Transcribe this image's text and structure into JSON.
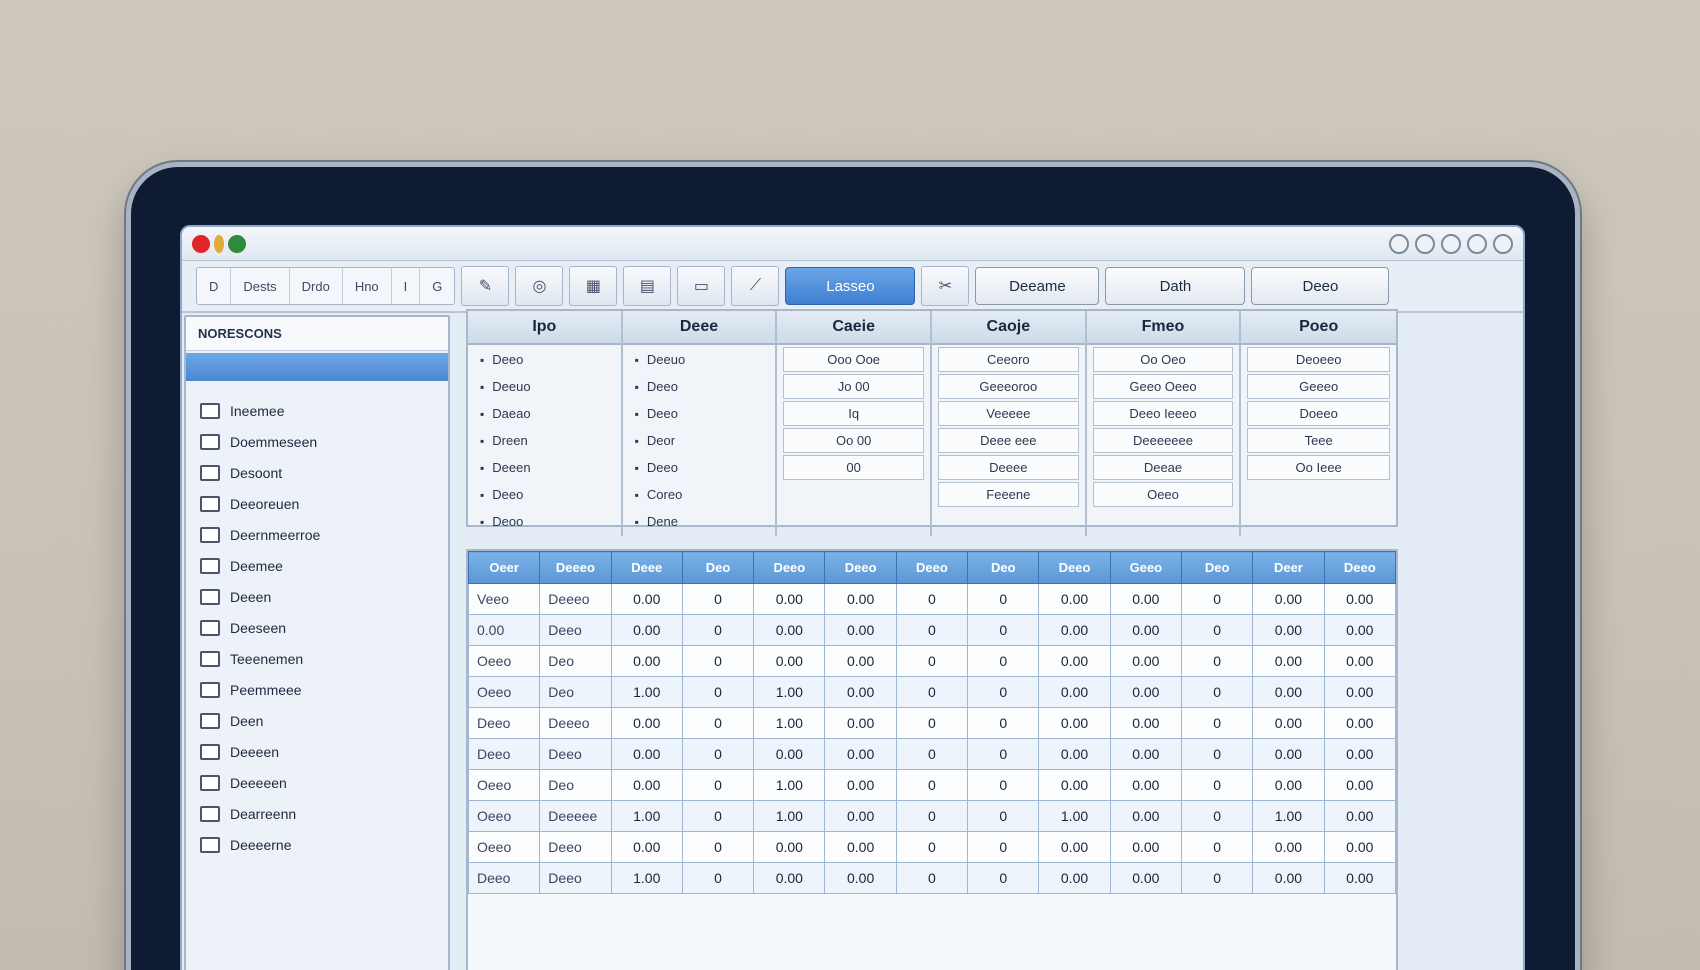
{
  "window": {
    "traffic_lights": [
      "red",
      "yellow",
      "green"
    ],
    "controls": [
      "minimize-icon",
      "info-icon",
      "sync-icon",
      "settings-icon",
      "close-icon"
    ]
  },
  "toolbar": {
    "segments": [
      "D",
      "Dests",
      "Drdo",
      "Hno",
      "I",
      "G"
    ],
    "icons": [
      "edit-icon",
      "circle-icon",
      "grid-icon",
      "chart-icon",
      "image-icon",
      "pen-icon",
      "text-icon",
      "cut-icon"
    ],
    "primary_label": "Lasseo",
    "buttons": [
      "Deeame",
      "Dath",
      "Deeo"
    ]
  },
  "sidebar": {
    "header": "NORESCONS",
    "selected": "",
    "items": [
      "Ineemee",
      "Doemmeseen",
      "Desoont",
      "Deeoreuen",
      "Deernmeerroe",
      "Deemee",
      "Deeen",
      "Deeseen",
      "Teeenemen",
      "Peemmeee",
      "Deen",
      "Deeeen",
      "Deeeeen",
      "Dearreenn",
      "Deeeerne"
    ]
  },
  "props": {
    "columns": [
      {
        "header": "Ipo",
        "rows": [
          "Deeo",
          "Deeuo",
          "Daeao",
          "Dreen",
          "Deeen",
          "Deeo",
          "Deoo"
        ]
      },
      {
        "header": "Deee",
        "rows": [
          "Deeuo",
          "Deeo",
          "Deeo",
          "Deor",
          "Deeo",
          "Coreo",
          "Dene"
        ]
      },
      {
        "header": "Caeie",
        "rows": [
          "Ooo  Ooe",
          "Jo  00",
          "  Iq",
          "Oo  00",
          "  00"
        ]
      },
      {
        "header": "Caoje",
        "rows": [
          "Ceeoro",
          "Geeeoroo",
          "Veeeee",
          "Deee eee",
          "Deeee",
          "Feeene"
        ]
      },
      {
        "header": "Fmeo",
        "rows": [
          "Oo Oeo",
          "Geeo Oeeo",
          "Deeo Ieeeo",
          "Deeeeeee",
          "Deeae",
          "Oeeo"
        ]
      },
      {
        "header": "Poeo",
        "rows": [
          "Deoeeo",
          "Geeeo",
          "Doeeo",
          "Teee",
          "Oo Ieee"
        ]
      }
    ]
  },
  "table": {
    "headers": [
      "Oeer",
      "Deeeo",
      "Deee",
      "Deo",
      "Deeo",
      "Deeo",
      "Deeo",
      "Deo",
      "Deeo",
      "Geeo",
      "Deo",
      "Deer",
      "Deeo"
    ],
    "rows": [
      [
        "Veeo",
        "Deeeo",
        "0.00",
        "0",
        "0.00",
        "0.00",
        "0",
        "0",
        "0.00",
        "0.00",
        "0",
        "0.00",
        "0.00"
      ],
      [
        "0.00",
        "Deeo",
        "0.00",
        "0",
        "0.00",
        "0.00",
        "0",
        "0",
        "0.00",
        "0.00",
        "0",
        "0.00",
        "0.00"
      ],
      [
        "Oeeo",
        "Deo",
        "0.00",
        "0",
        "0.00",
        "0.00",
        "0",
        "0",
        "0.00",
        "0.00",
        "0",
        "0.00",
        "0.00"
      ],
      [
        "Oeeo",
        "Deo",
        "1.00",
        "0",
        "1.00",
        "0.00",
        "0",
        "0",
        "0.00",
        "0.00",
        "0",
        "0.00",
        "0.00"
      ],
      [
        "Deeo",
        "Deeeo",
        "0.00",
        "0",
        "1.00",
        "0.00",
        "0",
        "0",
        "0.00",
        "0.00",
        "0",
        "0.00",
        "0.00"
      ],
      [
        "Deeo",
        "Deeo",
        "0.00",
        "0",
        "0.00",
        "0.00",
        "0",
        "0",
        "0.00",
        "0.00",
        "0",
        "0.00",
        "0.00"
      ],
      [
        "Oeeo",
        "Deo",
        "0.00",
        "0",
        "1.00",
        "0.00",
        "0",
        "0",
        "0.00",
        "0.00",
        "0",
        "0.00",
        "0.00"
      ],
      [
        "Oeeo",
        "Deeeee",
        "1.00",
        "0",
        "1.00",
        "0.00",
        "0",
        "0",
        "1.00",
        "0.00",
        "0",
        "1.00",
        "0.00"
      ],
      [
        "Oeeo",
        "Deeo",
        "0.00",
        "0",
        "0.00",
        "0.00",
        "0",
        "0",
        "0.00",
        "0.00",
        "0",
        "0.00",
        "0.00"
      ],
      [
        "Deeo",
        "Deeo",
        "1.00",
        "0",
        "0.00",
        "0.00",
        "0",
        "0",
        "0.00",
        "0.00",
        "0",
        "0.00",
        "0.00"
      ]
    ]
  },
  "colors": {
    "accent": "#4a88d3",
    "bezel": "#0f1a33",
    "close": "#e0242b"
  }
}
